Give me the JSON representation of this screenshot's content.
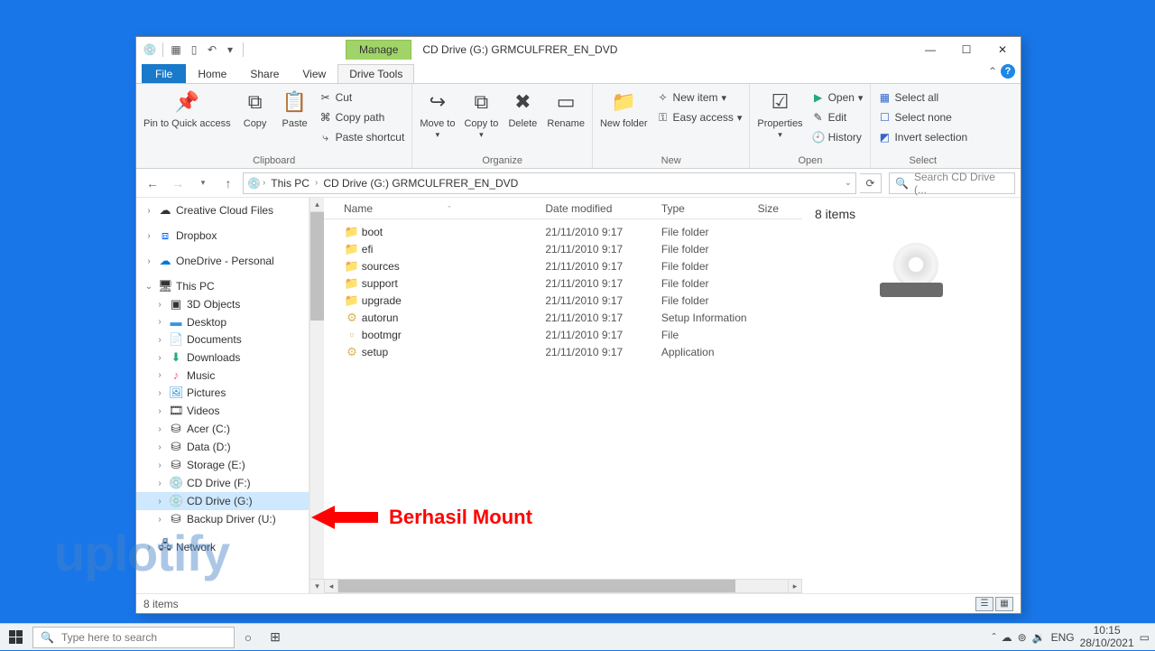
{
  "window": {
    "title": "CD Drive (G:) GRMCULFRER_EN_DVD",
    "manage_tab": "Manage"
  },
  "tabs": {
    "file": "File",
    "home": "Home",
    "share": "Share",
    "view": "View",
    "drive": "Drive Tools"
  },
  "ribbon": {
    "pin": "Pin to Quick access",
    "copy": "Copy",
    "paste": "Paste",
    "cut": "Cut",
    "copypath": "Copy path",
    "pasteshortcut": "Paste shortcut",
    "clipboard": "Clipboard",
    "moveto": "Move to",
    "copyto": "Copy to",
    "delete": "Delete",
    "rename": "Rename",
    "organize": "Organize",
    "newfolder": "New folder",
    "newitem": "New item",
    "easyaccess": "Easy access",
    "new": "New",
    "properties": "Properties",
    "open": "Open",
    "edit": "Edit",
    "history": "History",
    "open_grp": "Open",
    "selectall": "Select all",
    "selectnone": "Select none",
    "invert": "Invert selection",
    "select": "Select"
  },
  "nav": {
    "back": "←",
    "forward": "→",
    "up": "↑"
  },
  "address": {
    "pc": "This PC",
    "loc": "CD Drive (G:) GRMCULFRER_EN_DVD"
  },
  "search": {
    "placeholder": "Search CD Drive (..."
  },
  "tree": {
    "ccf": "Creative Cloud Files",
    "dropbox": "Dropbox",
    "onedrive": "OneDrive - Personal",
    "thispc": "This PC",
    "items": [
      "3D Objects",
      "Desktop",
      "Documents",
      "Downloads",
      "Music",
      "Pictures",
      "Videos",
      "Acer (C:)",
      "Data (D:)",
      "Storage (E:)",
      "CD Drive (F:)",
      "CD Drive (G:)",
      "Backup Driver (U:)"
    ],
    "network": "Network"
  },
  "columns": {
    "name": "Name",
    "date": "Date modified",
    "type": "Type",
    "size": "Size"
  },
  "files": [
    {
      "ic": "📁",
      "name": "boot",
      "date": "21/11/2010 9:17",
      "type": "File folder",
      "size": ""
    },
    {
      "ic": "📁",
      "name": "efi",
      "date": "21/11/2010 9:17",
      "type": "File folder",
      "size": ""
    },
    {
      "ic": "📁",
      "name": "sources",
      "date": "21/11/2010 9:17",
      "type": "File folder",
      "size": ""
    },
    {
      "ic": "📁",
      "name": "support",
      "date": "21/11/2010 9:17",
      "type": "File folder",
      "size": ""
    },
    {
      "ic": "📁",
      "name": "upgrade",
      "date": "21/11/2010 9:17",
      "type": "File folder",
      "size": ""
    },
    {
      "ic": "⚙",
      "name": "autorun",
      "date": "21/11/2010 9:17",
      "type": "Setup Information",
      "size": ""
    },
    {
      "ic": "▫",
      "name": "bootmgr",
      "date": "21/11/2010 9:17",
      "type": "File",
      "size": ""
    },
    {
      "ic": "⚙",
      "name": "setup",
      "date": "21/11/2010 9:17",
      "type": "Application",
      "size": ""
    }
  ],
  "details": {
    "count": "8 items"
  },
  "status": {
    "count": "8 items"
  },
  "annotation": {
    "text": "Berhasil Mount"
  },
  "watermark": "uplotify",
  "taskbar": {
    "search": "Type here to search",
    "time": "10:15",
    "date": "28/10/2021",
    "lang": "ENG"
  }
}
